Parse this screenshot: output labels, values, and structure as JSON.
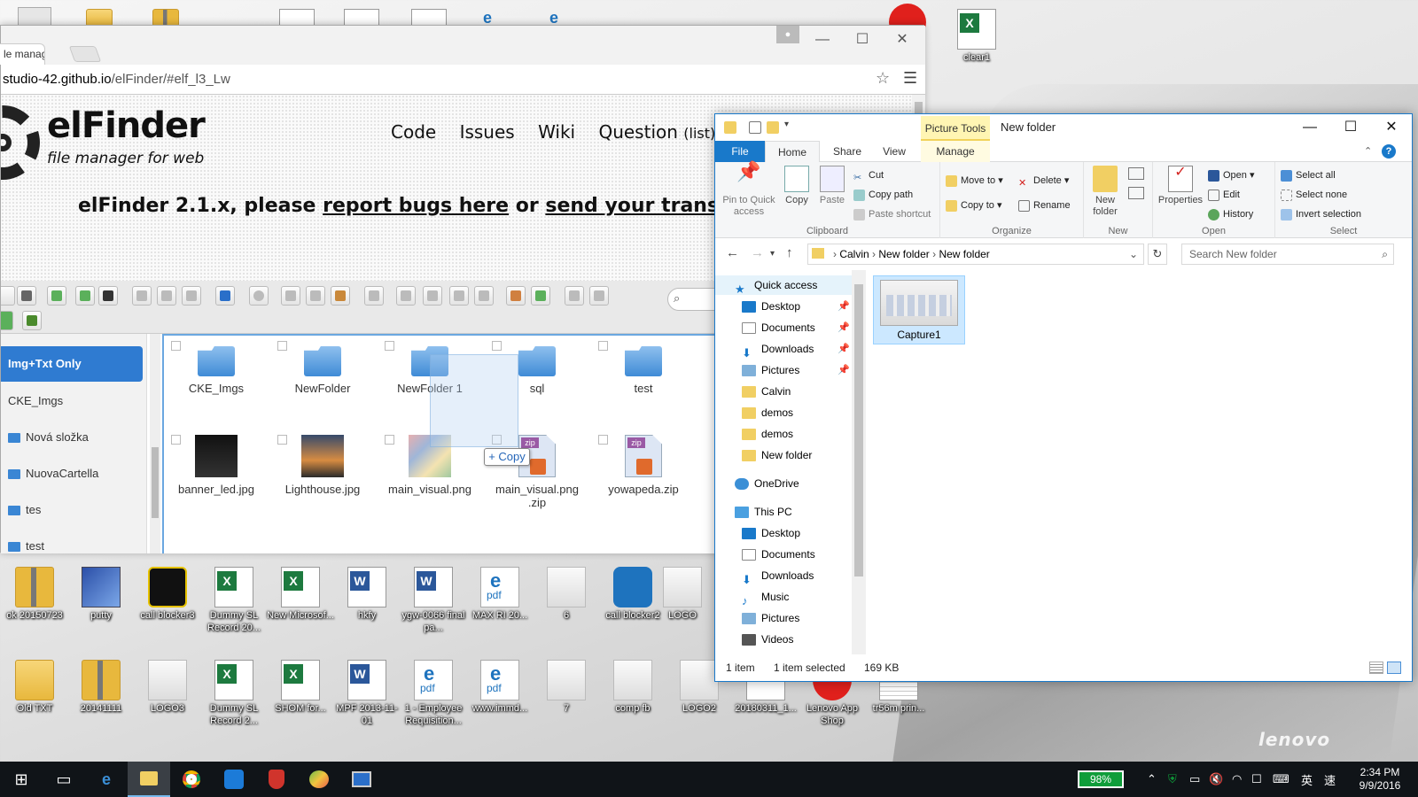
{
  "desktop": {
    "top_icons": [
      {
        "label": "clear1",
        "kind": "excel"
      }
    ],
    "row1": [
      {
        "label": "ok 20150723",
        "kind": "zip"
      },
      {
        "label": "putty",
        "kind": "app"
      },
      {
        "label": "call blocker3",
        "kind": "app"
      },
      {
        "label": "Dummy SL Record 20...",
        "kind": "excel"
      },
      {
        "label": "New Microsof...",
        "kind": "excel"
      },
      {
        "label": "hkfy",
        "kind": "word"
      },
      {
        "label": "ygw-0066 final pa...",
        "kind": "word"
      },
      {
        "label": "MAX RI 20...",
        "kind": "pdf"
      },
      {
        "label": "6",
        "kind": "image"
      },
      {
        "label": "call blocker2",
        "kind": "app"
      },
      {
        "label": "LOGO",
        "kind": "image"
      }
    ],
    "row2": [
      {
        "label": "Old TXT",
        "kind": "zip"
      },
      {
        "label": "20141111",
        "kind": "zip"
      },
      {
        "label": "LOGO3",
        "kind": "image"
      },
      {
        "label": "Dummy SL Record 2...",
        "kind": "excel"
      },
      {
        "label": "SHOM for...",
        "kind": "excel"
      },
      {
        "label": "MPF 2013-11-01",
        "kind": "word"
      },
      {
        "label": "1 - Employee Requisition...",
        "kind": "pdf"
      },
      {
        "label": "www.immd...",
        "kind": "pdf"
      },
      {
        "label": "7",
        "kind": "image"
      },
      {
        "label": "comp fb",
        "kind": "image"
      },
      {
        "label": "LOGO2",
        "kind": "image"
      },
      {
        "label": "20180311_1...",
        "kind": "file"
      },
      {
        "label": "Lenovo App Shop",
        "kind": "app"
      },
      {
        "label": "tr56m prin...",
        "kind": "file"
      }
    ],
    "watermark": "lenovo"
  },
  "browser": {
    "tab_title": "le manag",
    "url_host": "studio-42.github.io",
    "url_path": "/elFinder/#elf_l3_Lw",
    "site": {
      "brand": "elFinder",
      "tagline": "file manager for web",
      "nav": [
        "Code",
        "Issues",
        "Wiki",
        "Question"
      ],
      "nav_suffix": "(list)",
      "banner_prefix": "elFinder 2.1.x, please ",
      "banner_link1": "report bugs here",
      "banner_mid": " or ",
      "banner_link2": "send your translation"
    },
    "elfinder": {
      "tree": [
        {
          "label": "Img+Txt Only",
          "selected": true
        },
        {
          "label": "CKE_Imgs"
        },
        {
          "label": "Nová složka"
        },
        {
          "label": "NuovaCartella"
        },
        {
          "label": "tes"
        },
        {
          "label": "test"
        }
      ],
      "files": [
        {
          "label": "CKE_Imgs",
          "type": "folder"
        },
        {
          "label": "NewFolder",
          "type": "folder"
        },
        {
          "label": "NewFolder 1",
          "type": "folder"
        },
        {
          "label": "sql",
          "type": "folder"
        },
        {
          "label": "test",
          "type": "folder"
        },
        {
          "label": "banner_led.jpg",
          "type": "image"
        },
        {
          "label": "Lighthouse.jpg",
          "type": "image"
        },
        {
          "label": "main_visual.png",
          "type": "image"
        },
        {
          "label": "main_visual.png .zip",
          "type": "zip"
        },
        {
          "label": "yowapeda.zip",
          "type": "zip"
        }
      ],
      "drag_label": "+ Copy",
      "zip_badge": "zip"
    }
  },
  "explorer": {
    "title": "New folder",
    "picture_tools": "Picture Tools",
    "tabs": [
      "File",
      "Home",
      "Share",
      "View",
      "Manage"
    ],
    "clipboard": {
      "pin": "Pin to Quick access",
      "copy": "Copy",
      "paste": "Paste",
      "cut": "Cut",
      "copy_path": "Copy path",
      "paste_shortcut": "Paste shortcut",
      "group": "Clipboard"
    },
    "organize": {
      "move_to": "Move to",
      "copy_to": "Copy to",
      "delete": "Delete",
      "rename": "Rename",
      "group": "Organize"
    },
    "new": {
      "new_folder": "New folder",
      "group": "New"
    },
    "open": {
      "properties": "Properties",
      "open": "Open",
      "edit": "Edit",
      "history": "History",
      "group": "Open"
    },
    "select": {
      "all": "Select all",
      "none": "Select none",
      "invert": "Invert selection",
      "group": "Select"
    },
    "breadcrumb": [
      "Calvin",
      "New folder",
      "New folder"
    ],
    "search_placeholder": "Search New folder",
    "nav": [
      {
        "label": "Quick access",
        "icon": "star-icon",
        "pinned": false
      },
      {
        "label": "Desktop",
        "icon": "desktop-icon",
        "pinned": true
      },
      {
        "label": "Documents",
        "icon": "documents-icon",
        "pinned": true
      },
      {
        "label": "Downloads",
        "icon": "downloads-icon",
        "pinned": true
      },
      {
        "label": "Pictures",
        "icon": "pictures-icon",
        "pinned": true
      },
      {
        "label": "Calvin",
        "icon": "folder-icon",
        "pinned": false
      },
      {
        "label": "demos",
        "icon": "folder-icon",
        "pinned": false
      },
      {
        "label": "demos",
        "icon": "folder-icon",
        "pinned": false
      },
      {
        "label": "New folder",
        "icon": "folder-icon",
        "pinned": false
      },
      {
        "label": "OneDrive",
        "icon": "cloud-icon",
        "pinned": false
      },
      {
        "label": "This PC",
        "icon": "computer-icon",
        "pinned": false
      },
      {
        "label": "Desktop",
        "icon": "desktop-icon",
        "pinned": false
      },
      {
        "label": "Documents",
        "icon": "documents-icon",
        "pinned": false
      },
      {
        "label": "Downloads",
        "icon": "downloads-icon",
        "pinned": false
      },
      {
        "label": "Music",
        "icon": "music-icon",
        "pinned": false
      },
      {
        "label": "Pictures",
        "icon": "pictures-icon",
        "pinned": false
      },
      {
        "label": "Videos",
        "icon": "videos-icon",
        "pinned": false
      }
    ],
    "files": [
      {
        "label": "Capture1",
        "selected": true
      }
    ],
    "status": {
      "count": "1 item",
      "selected": "1 item selected",
      "size": "169 KB"
    }
  },
  "taskbar": {
    "battery": "98%",
    "ime1": "英",
    "ime2": "速",
    "time": "2:34 PM",
    "date": "9/9/2016"
  },
  "colors": {
    "accent": "#1979ca",
    "selection": "#cce8ff",
    "elfinder_sel": "#2f7bd1",
    "taskbar": "#101418"
  }
}
